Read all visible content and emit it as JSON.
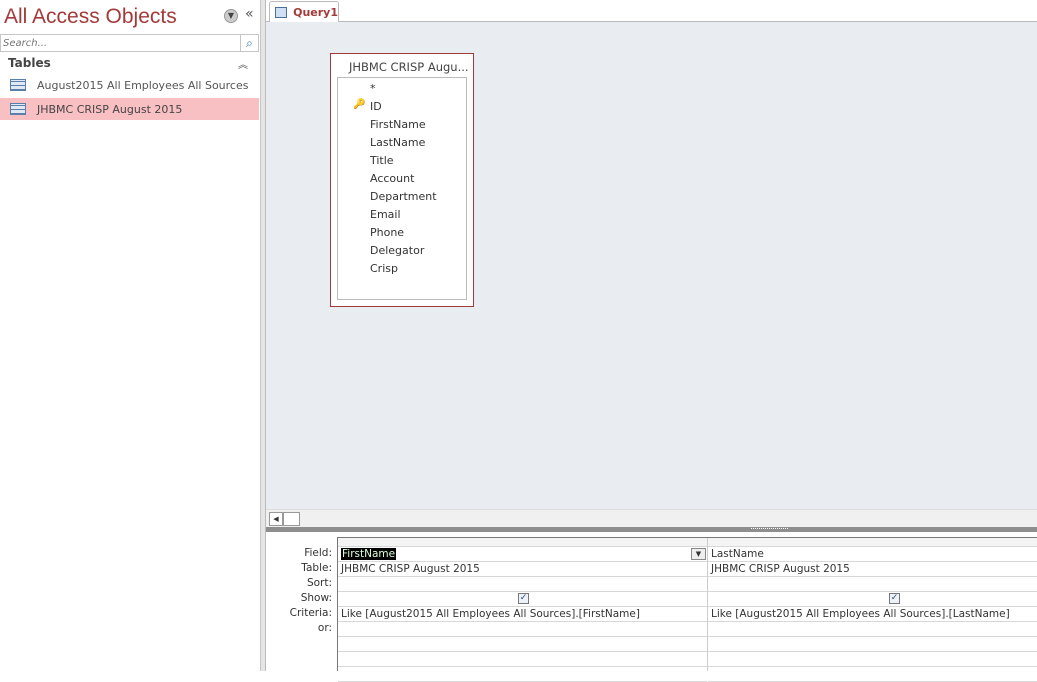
{
  "nav": {
    "title": "All Access Objects",
    "search_placeholder": "Search...",
    "group": "Tables",
    "items": [
      {
        "label": "August2015 All Employees All Sources"
      },
      {
        "label": "JHBMC CRISP August 2015",
        "selected": true
      }
    ]
  },
  "tab": {
    "label": "Query1"
  },
  "field_list": {
    "title": "JHBMC CRISP Augu...",
    "fields": [
      "*",
      "ID",
      "FirstName",
      "LastName",
      "Title",
      "Account",
      "Department",
      "Email",
      "Phone",
      "Delegator",
      "Crisp"
    ],
    "primary_key": "ID"
  },
  "grid": {
    "row_labels": [
      "Field:",
      "Table:",
      "Sort:",
      "Show:",
      "Criteria:",
      "or:"
    ],
    "columns": [
      {
        "field": "FirstName",
        "table": "JHBMC CRISP August 2015",
        "sort": "",
        "show": true,
        "criteria": "Like [August2015 All Employees All Sources].[FirstName]",
        "or": ""
      },
      {
        "field": "LastName",
        "table": "JHBMC CRISP August 2015",
        "sort": "",
        "show": true,
        "criteria": "Like [August2015 All Employees All Sources].[LastName]",
        "or": ""
      }
    ]
  },
  "colors": {
    "accent": "#a33a3a",
    "selected": "#f9c0c4",
    "design_bg": "#e9edf2"
  }
}
